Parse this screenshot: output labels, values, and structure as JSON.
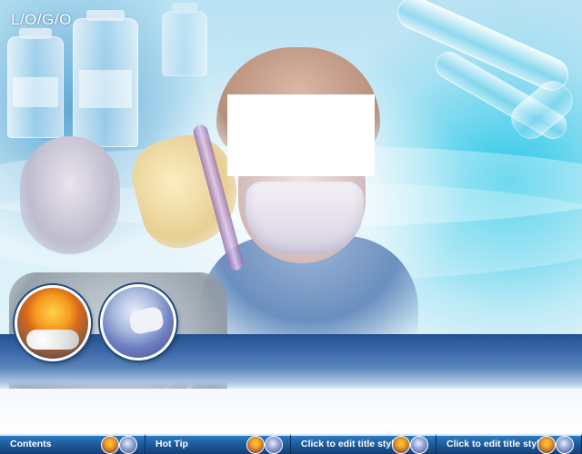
{
  "logo": {
    "text": "L/O/G/O"
  },
  "slide": {
    "photo_left": "medicine-pills-photo",
    "photo_right": "surgeon-photo"
  },
  "thumbnails": [
    {
      "label": "Contents"
    },
    {
      "label": "Hot Tip"
    },
    {
      "label": "Click to edit title style"
    },
    {
      "label": "Click to edit title style"
    }
  ],
  "colors": {
    "band_blue": "#3b69a8",
    "strip_blue": "#1d5c9e"
  }
}
